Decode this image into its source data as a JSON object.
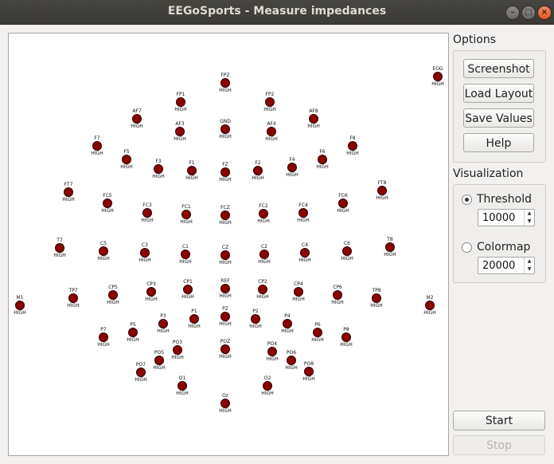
{
  "window": {
    "title": "EEGoSports - Measure impedances"
  },
  "options": {
    "title": "Options",
    "buttons": [
      "Screenshot",
      "Load Layout",
      "Save Values",
      "Help"
    ]
  },
  "visualization": {
    "title": "Visualization",
    "threshold": {
      "label": "Threshold",
      "value": "10000",
      "checked": true
    },
    "colormap": {
      "label": "Colormap",
      "value": "20000",
      "checked": false
    }
  },
  "actions": {
    "start": "Start",
    "stop": "Stop"
  },
  "colors": {
    "electrode": "#8b0000",
    "canvas": "#ffffff"
  },
  "electrodes": [
    {
      "name": "FPZ",
      "value": "HIGH"
    },
    {
      "name": "FP1",
      "value": "HIGH"
    },
    {
      "name": "FP2",
      "value": "HIGH"
    },
    {
      "name": "EOG",
      "value": "HIGH"
    },
    {
      "name": "AF7",
      "value": "HIGH"
    },
    {
      "name": "AF8",
      "value": "HIGH"
    },
    {
      "name": "AF3",
      "value": "HIGH"
    },
    {
      "name": "GND",
      "value": "HIGH"
    },
    {
      "name": "AF4",
      "value": "HIGH"
    },
    {
      "name": "F7",
      "value": "HIGH"
    },
    {
      "name": "F8",
      "value": "HIGH"
    },
    {
      "name": "F5",
      "value": "HIGH"
    },
    {
      "name": "F6",
      "value": "HIGH"
    },
    {
      "name": "F3",
      "value": "HIGH"
    },
    {
      "name": "F4",
      "value": "HIGH"
    },
    {
      "name": "F1",
      "value": "HIGH"
    },
    {
      "name": "FZ",
      "value": "HIGH"
    },
    {
      "name": "F2",
      "value": "HIGH"
    },
    {
      "name": "FT7",
      "value": "HIGH"
    },
    {
      "name": "FT8",
      "value": "HIGH"
    },
    {
      "name": "FC5",
      "value": "HIGH"
    },
    {
      "name": "FC6",
      "value": "HIGH"
    },
    {
      "name": "FC3",
      "value": "HIGH"
    },
    {
      "name": "FC4",
      "value": "HIGH"
    },
    {
      "name": "FC1",
      "value": "HIGH"
    },
    {
      "name": "FCZ",
      "value": "HIGH"
    },
    {
      "name": "FC2",
      "value": "HIGH"
    },
    {
      "name": "T7",
      "value": "HIGH"
    },
    {
      "name": "C5",
      "value": "HIGH"
    },
    {
      "name": "C3",
      "value": "HIGH"
    },
    {
      "name": "C1",
      "value": "HIGH"
    },
    {
      "name": "CZ",
      "value": "HIGH"
    },
    {
      "name": "C2",
      "value": "HIGH"
    },
    {
      "name": "C4",
      "value": "HIGH"
    },
    {
      "name": "C6",
      "value": "HIGH"
    },
    {
      "name": "T8",
      "value": "HIGH"
    },
    {
      "name": "M1",
      "value": "HIGH"
    },
    {
      "name": "TP7",
      "value": "HIGH"
    },
    {
      "name": "CP5",
      "value": "HIGH"
    },
    {
      "name": "CP3",
      "value": "HIGH"
    },
    {
      "name": "CP1",
      "value": "HIGH"
    },
    {
      "name": "REF",
      "value": "HIGH"
    },
    {
      "name": "CP2",
      "value": "HIGH"
    },
    {
      "name": "CP4",
      "value": "HIGH"
    },
    {
      "name": "CP6",
      "value": "HIGH"
    },
    {
      "name": "TP8",
      "value": "HIGH"
    },
    {
      "name": "M2",
      "value": "HIGH"
    },
    {
      "name": "P7",
      "value": "HIGH"
    },
    {
      "name": "P5",
      "value": "HIGH"
    },
    {
      "name": "P3",
      "value": "HIGH"
    },
    {
      "name": "P1",
      "value": "HIGH"
    },
    {
      "name": "PZ",
      "value": "HIGH"
    },
    {
      "name": "P2",
      "value": "HIGH"
    },
    {
      "name": "P4",
      "value": "HIGH"
    },
    {
      "name": "P6",
      "value": "HIGH"
    },
    {
      "name": "P8",
      "value": "HIGH"
    },
    {
      "name": "PO7",
      "value": "HIGH"
    },
    {
      "name": "PO5",
      "value": "HIGH"
    },
    {
      "name": "PO3",
      "value": "HIGH"
    },
    {
      "name": "POZ",
      "value": "HIGH"
    },
    {
      "name": "PO4",
      "value": "HIGH"
    },
    {
      "name": "PO6",
      "value": "HIGH"
    },
    {
      "name": "PO8",
      "value": "HIGH"
    },
    {
      "name": "O1",
      "value": "HIGH"
    },
    {
      "name": "O2",
      "value": "HIGH"
    },
    {
      "name": "Oz",
      "value": "HIGH"
    }
  ]
}
